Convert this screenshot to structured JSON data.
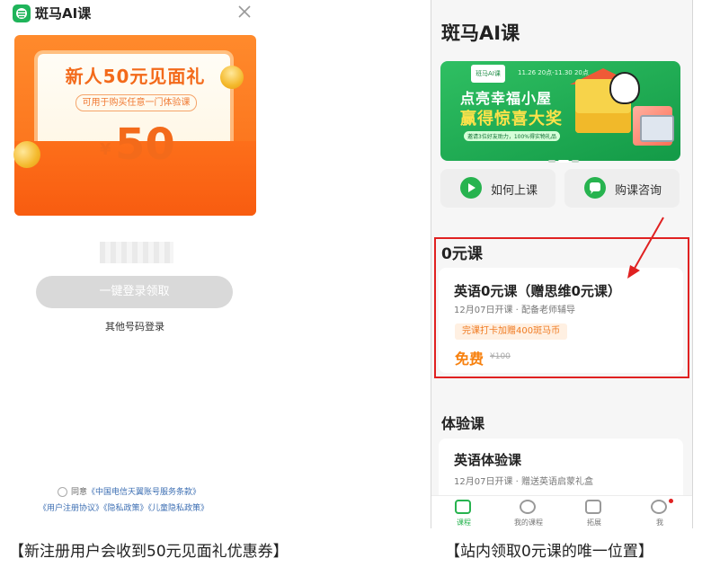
{
  "left": {
    "app_name": "斑马AI课",
    "coupon": {
      "title": "新人50元见面礼",
      "subtitle": "可用于购买任意一门体验课",
      "currency": "¥",
      "amount": "50"
    },
    "login_button": "一键登录领取",
    "other_login": "其他号码登录",
    "agreement": {
      "agree": "同意",
      "telecom_terms": "《中国电信天翼账号服务条款》",
      "user_agreement": "《用户注册协议》",
      "privacy": "《隐私政策》",
      "child_privacy": "《儿童隐私政策》"
    },
    "caption": "【新注册用户会收到50元见面礼优惠券】"
  },
  "right": {
    "title": "斑马AI课",
    "banner": {
      "brand": "班马AI课",
      "date": "11.26 20点-11.30 20点",
      "line1": "点亮幸福小屋",
      "line2": "赢得惊喜大奖",
      "note": "邀请3位好友助力，100%得实物礼品"
    },
    "quick_actions": [
      {
        "label": "如何上课",
        "icon": "play-icon"
      },
      {
        "label": "购课咨询",
        "icon": "chat-icon"
      }
    ],
    "section_free": {
      "title": "0元课",
      "course": {
        "title": "英语0元课（赠思维0元课）",
        "meta": "12月07日开课 · 配备老师辅导",
        "tag": "完课打卡加赠400斑马币",
        "price": "免费",
        "original_price": "¥100"
      }
    },
    "section_trial": {
      "title": "体验课",
      "course": {
        "title": "英语体验课",
        "meta": "12月07日开课 · 赠送英语启蒙礼盒"
      }
    },
    "tabs": [
      {
        "label": "课程",
        "active": true
      },
      {
        "label": "我的课程",
        "active": false
      },
      {
        "label": "拓展",
        "active": false
      },
      {
        "label": "我",
        "active": false,
        "badge": true
      }
    ],
    "caption": "【站内领取0元课的唯一位置】"
  },
  "colors": {
    "brand_green": "#27b34f",
    "coupon_orange": "#fa6a16",
    "highlight_red": "#e02121",
    "price_orange": "#f7810f"
  }
}
